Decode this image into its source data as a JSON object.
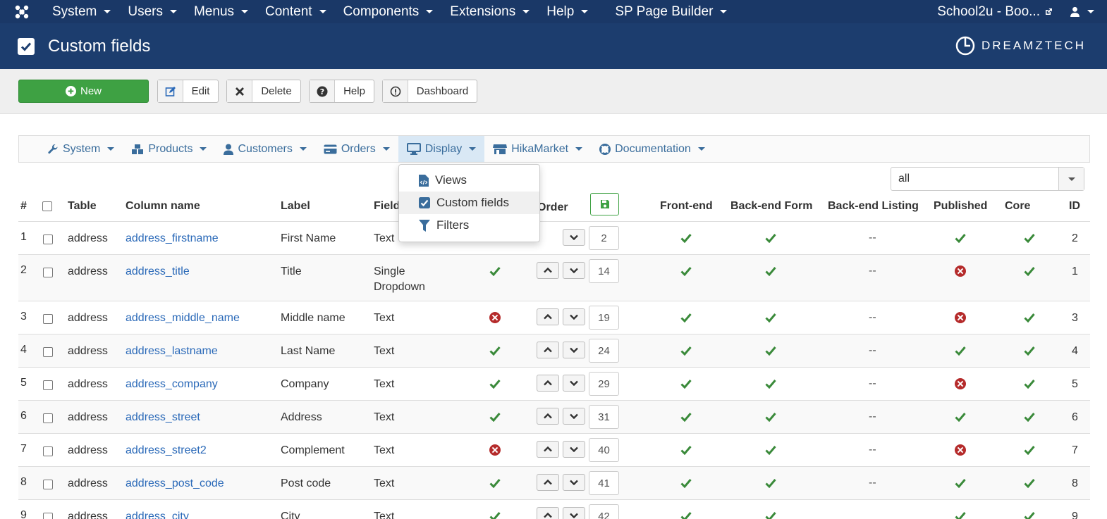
{
  "topnav": {
    "items": [
      "System",
      "Users",
      "Menus",
      "Content",
      "Components",
      "Extensions",
      "Help",
      "SP Page Builder"
    ],
    "site": "School2u - Boo..."
  },
  "header": {
    "title": "Custom fields",
    "brand": "DREAMZTECH"
  },
  "toolbar": {
    "new": "New",
    "edit": "Edit",
    "delete": "Delete",
    "help": "Help",
    "dashboard": "Dashboard"
  },
  "subnav": {
    "items": [
      "System",
      "Products",
      "Customers",
      "Orders",
      "Display",
      "HikaMarket",
      "Documentation"
    ]
  },
  "dropdown": {
    "items": [
      "Views",
      "Custom fields",
      "Filters"
    ]
  },
  "filter": {
    "value": "all"
  },
  "table": {
    "headers": {
      "num": "#",
      "table": "Table",
      "column": "Column name",
      "label": "Label",
      "field": "Field",
      "order": "Order",
      "frontend": "Front-end",
      "backform": "Back-end Form",
      "backlist": "Back-end Listing",
      "published": "Published",
      "core": "Core",
      "id": "ID"
    },
    "rows": [
      {
        "n": "1",
        "table": "address",
        "column": "address_firstname",
        "label": "First Name",
        "type": "Text",
        "order": "2",
        "id": "2",
        "backlist": "--"
      },
      {
        "n": "2",
        "table": "address",
        "column": "address_title",
        "label": "Title",
        "type": "Single",
        "type2": "Dropdown",
        "order": "14",
        "id": "1",
        "backlist": "--"
      },
      {
        "n": "3",
        "table": "address",
        "column": "address_middle_name",
        "label": "Middle name",
        "type": "Text",
        "order": "19",
        "id": "3",
        "backlist": "--"
      },
      {
        "n": "4",
        "table": "address",
        "column": "address_lastname",
        "label": "Last Name",
        "type": "Text",
        "order": "24",
        "id": "4",
        "backlist": "--"
      },
      {
        "n": "5",
        "table": "address",
        "column": "address_company",
        "label": "Company",
        "type": "Text",
        "order": "29",
        "id": "5",
        "backlist": "--"
      },
      {
        "n": "6",
        "table": "address",
        "column": "address_street",
        "label": "Address",
        "type": "Text",
        "order": "31",
        "id": "6",
        "backlist": "--"
      },
      {
        "n": "7",
        "table": "address",
        "column": "address_street2",
        "label": "Complement",
        "type": "Text",
        "order": "40",
        "id": "7",
        "backlist": "--"
      },
      {
        "n": "8",
        "table": "address",
        "column": "address_post_code",
        "label": "Post code",
        "type": "Text",
        "order": "41",
        "id": "8",
        "backlist": "--"
      },
      {
        "n": "9",
        "table": "address",
        "column": "address_city",
        "label": "City",
        "type": "Text",
        "order": "42",
        "id": "9",
        "backlist": ""
      }
    ]
  },
  "colors": {
    "topnav": "#1a3867",
    "header": "#1c3d6e",
    "green": "#3ea143",
    "link": "#2a69b8",
    "danger": "#b52b2b"
  }
}
